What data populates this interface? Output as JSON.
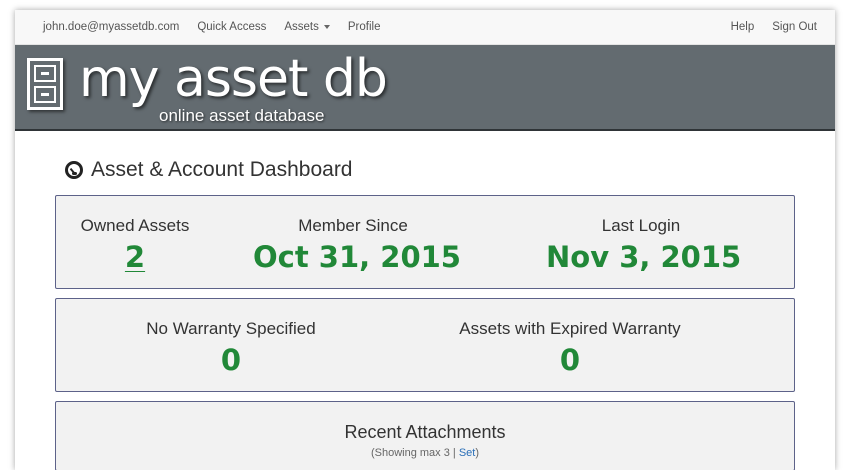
{
  "nav": {
    "user_email": "john.doe@myassetdb.com",
    "quick_access": "Quick Access",
    "assets": "Assets",
    "profile": "Profile",
    "help": "Help",
    "sign_out": "Sign Out"
  },
  "brand": {
    "title": "my asset db",
    "subtitle": "online asset database"
  },
  "dashboard": {
    "title": "Asset & Account Dashboard",
    "owned_assets_label": "Owned Assets",
    "owned_assets_value": "2",
    "member_since_label": "Member Since",
    "member_since_value": "Oct 31, 2015",
    "last_login_label": "Last Login",
    "last_login_value": "Nov 3, 2015",
    "no_warranty_label": "No Warranty Specified",
    "no_warranty_value": "0",
    "expired_warranty_label": "Assets with Expired Warranty",
    "expired_warranty_value": "0",
    "recent_attachments_title": "Recent Attachments",
    "showing_prefix": "(Showing max 3 | ",
    "set_link": "Set",
    "showing_suffix": ")"
  },
  "colors": {
    "banner": "#636b70",
    "value_green": "#218838",
    "panel_border": "#5d6289",
    "panel_bg": "#f2f2f2"
  }
}
